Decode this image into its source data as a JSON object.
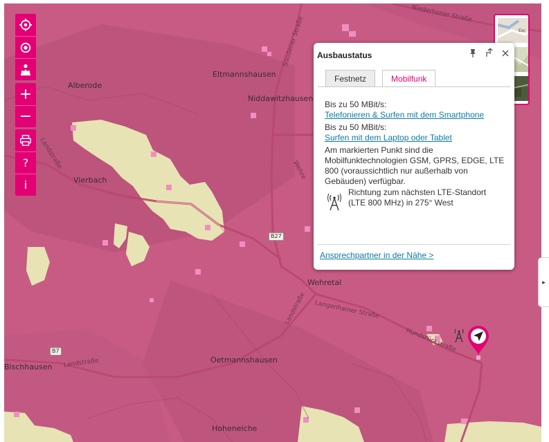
{
  "colors": {
    "accent": "#e20074",
    "coverage": "#c85b84",
    "nocoverage": "#e7e3b5",
    "link": "#0e7aa5"
  },
  "toolbar": {
    "group1": [
      {
        "icon": "crosshair-icon"
      },
      {
        "icon": "locate-icon"
      },
      {
        "icon": "map-reader-icon"
      }
    ],
    "zoom": {
      "in_label": "+",
      "out_label": "−"
    },
    "group3": {
      "print_icon": "print-icon",
      "help_label": "?",
      "info_label": "i"
    }
  },
  "map": {
    "places": {
      "alberode": "Alberode",
      "eltmannshausen": "Eltmannshausen",
      "niddawitzhausen": "Niddawitzhausen",
      "vierbach": "Vierbach",
      "wehretal": "Wehretal",
      "oetmannshausen": "Oetmannshausen",
      "bischhausen": "Bischhausen",
      "hoheneiche": "Hoheneiche"
    },
    "roads": {
      "niederhoner": "Niederhoner Straße",
      "soodener": "Soodener Straße",
      "landstrasse_left": "Landstraße",
      "landstrasse_mid": "Landstraße",
      "langenhainer": "Langenhainer Straße",
      "hundsruecken": "Hundsrückstraße",
      "wehre": "Wehre"
    },
    "shields": {
      "b27": "B27",
      "b7": "B7"
    }
  },
  "layers": {
    "thumb_text": "Esc"
  },
  "popup": {
    "title": "Ausbaustatus",
    "tabs": {
      "festnetz": "Festnetz",
      "mobilfunk": "Mobilfunk"
    },
    "speed1": "Bis zu 50 MBit/s:",
    "link1": "Telefonieren & Surfen mit dem Smartphone",
    "speed2": "Bis zu 50 MBit/s:",
    "link2": "Surfen mit dem Laptop oder Tablet",
    "description": "Am markierten Punkt sind die Mobilfunktechnologien GSM, GPRS, EDGE, LTE 800 (voraussichtlich nur außerhalb von Gebäuden) verfügbar.",
    "lte_direction": "Richtung zum nächsten LTE-Standort (LTE 800 MHz) in 275° West",
    "contact_link": "Ansprechpartner in der Nähe >"
  },
  "sidebar_toggle": {
    "label": "▸"
  }
}
